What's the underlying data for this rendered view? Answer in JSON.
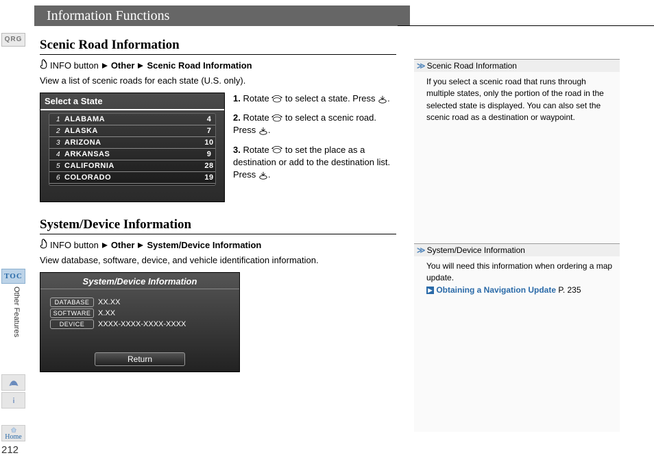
{
  "banner": "Information Functions",
  "sidebar": {
    "qrg": "QRG",
    "toc": "TOC",
    "other": "Other Features",
    "home": "Home"
  },
  "page_number": "212",
  "section1": {
    "title": "Scenic Road Information",
    "crumb_pre": "INFO button",
    "crumb_mid": "Other",
    "crumb_end": "Scenic Road Information",
    "intro": "View a list of scenic roads for each state (U.S. only).",
    "screenshot": {
      "title": "Select a State",
      "rows": [
        {
          "idx": "1",
          "name": "ALABAMA",
          "cnt": "4"
        },
        {
          "idx": "2",
          "name": "ALASKA",
          "cnt": "7"
        },
        {
          "idx": "3",
          "name": "ARIZONA",
          "cnt": "10"
        },
        {
          "idx": "4",
          "name": "ARKANSAS",
          "cnt": "9"
        },
        {
          "idx": "5",
          "name": "CALIFORNIA",
          "cnt": "28"
        },
        {
          "idx": "6",
          "name": "COLORADO",
          "cnt": "19"
        }
      ]
    },
    "steps": {
      "s1a": "Rotate",
      "s1b": "to select a state. Press",
      "s1c": ".",
      "s2a": "Rotate",
      "s2b": "to select a scenic road. Press",
      "s2c": ".",
      "s3a": "Rotate",
      "s3b": "to set the place as a destination or add to the destination list. Press",
      "s3c": "."
    }
  },
  "section2": {
    "title": "System/Device Information",
    "crumb_pre": "INFO button",
    "crumb_mid": "Other",
    "crumb_end": "System/Device Information",
    "intro": "View database, software, device, and vehicle identification information.",
    "screenshot": {
      "title": "System/Device Information",
      "rows": [
        {
          "label": "DATABASE",
          "val": "XX.XX"
        },
        {
          "label": "SOFTWARE",
          "val": "X.XX"
        },
        {
          "label": "DEVICE",
          "val": "XXXX-XXXX-XXXX-XXXX"
        }
      ],
      "return": "Return"
    }
  },
  "right1": {
    "head": "Scenic Road Information",
    "body": "If you select a scenic road that runs through multiple states, only the portion of the road in the selected state is displayed. You can also set the scenic road as a destination or waypoint."
  },
  "right2": {
    "head": "System/Device Information",
    "body": "You will need this information when ordering a map update.",
    "link": "Obtaining a Navigation Update",
    "link_page": "P. 235"
  }
}
